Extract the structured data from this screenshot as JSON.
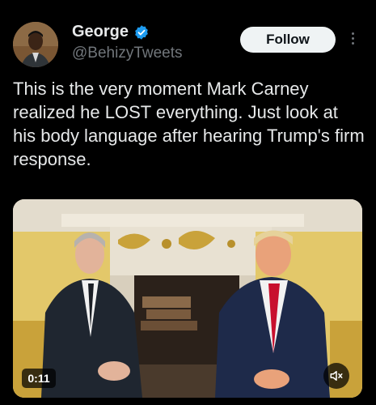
{
  "author": {
    "display_name": "George",
    "handle": "@BehizyTweets",
    "verified": true,
    "verified_color": "#1d9bf0"
  },
  "actions": {
    "follow_label": "Follow"
  },
  "tweet": {
    "text": "This is the very moment Mark Carney realized he LOST everything. Just look at his body language after hearing Trump's firm response."
  },
  "media": {
    "type": "video",
    "duration": "0:11",
    "muted": true
  },
  "icons": {
    "verified": "verified-badge-icon",
    "more": "more-options-icon",
    "mute": "muted-speaker-icon"
  }
}
